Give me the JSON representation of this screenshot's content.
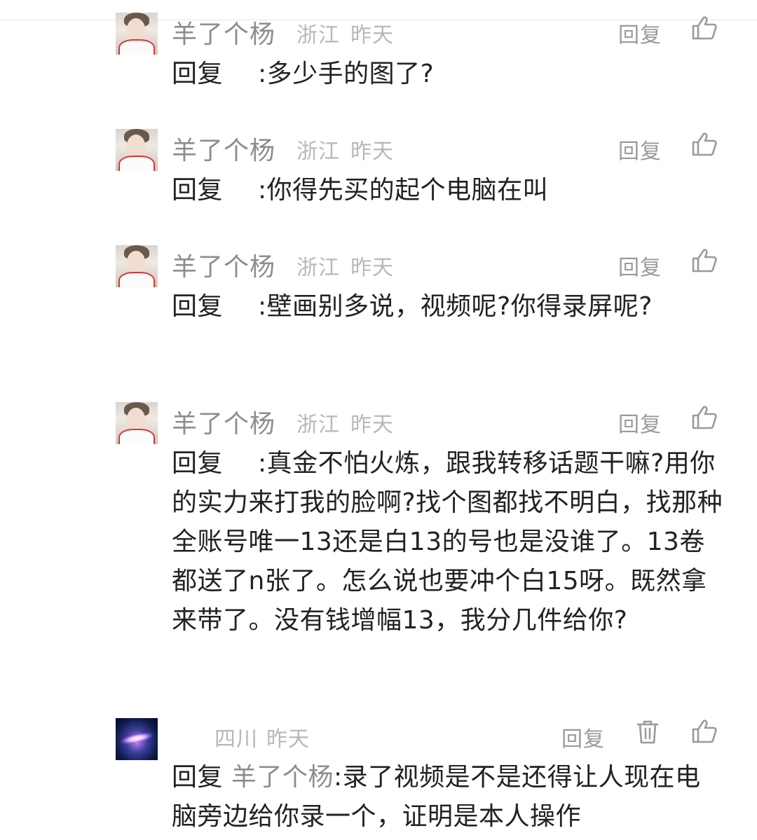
{
  "comments": [
    {
      "user": "羊了个杨",
      "location": "浙江",
      "time": "昨天",
      "reply_label": "回复",
      "reply_prefix": "回复",
      "reply_target": "",
      "text": ":多少手的图了?"
    },
    {
      "user": "羊了个杨",
      "location": "浙江",
      "time": "昨天",
      "reply_label": "回复",
      "reply_prefix": "回复",
      "reply_target": "",
      "text": ":你得先买的起个电脑在叫"
    },
    {
      "user": "羊了个杨",
      "location": "浙江",
      "time": "昨天",
      "reply_label": "回复",
      "reply_prefix": "回复",
      "reply_target": "",
      "text": ":壁画别多说，视频呢?你得录屏呢?"
    },
    {
      "user": "羊了个杨",
      "location": "浙江",
      "time": "昨天",
      "reply_label": "回复",
      "reply_prefix": "回复",
      "reply_target": "",
      "text": ":真金不怕火炼，跟我转移话题干嘛?用你的实力来打我的脸啊?找个图都找不明白，找那种全账号唯一13还是白13的号也是没谁了。13卷都送了n张了。怎么说也要冲个白15呀。既然拿来带了。没有钱增幅13，我分几件给你?"
    },
    {
      "user": "",
      "location": "四川",
      "time": "昨天",
      "reply_label": "回复",
      "reply_prefix": "回复",
      "reply_target": "羊了个杨",
      "text": ":录了视频是不是还得让人现在电脑旁边给你录一个，证明是本人操作"
    }
  ],
  "icons": {
    "like": "thumbs-up-icon",
    "delete": "trash-icon"
  },
  "colors": {
    "name": "#8d8d8d",
    "meta": "#b8b8b8",
    "text": "#222222",
    "icon": "#9a9a9a"
  }
}
